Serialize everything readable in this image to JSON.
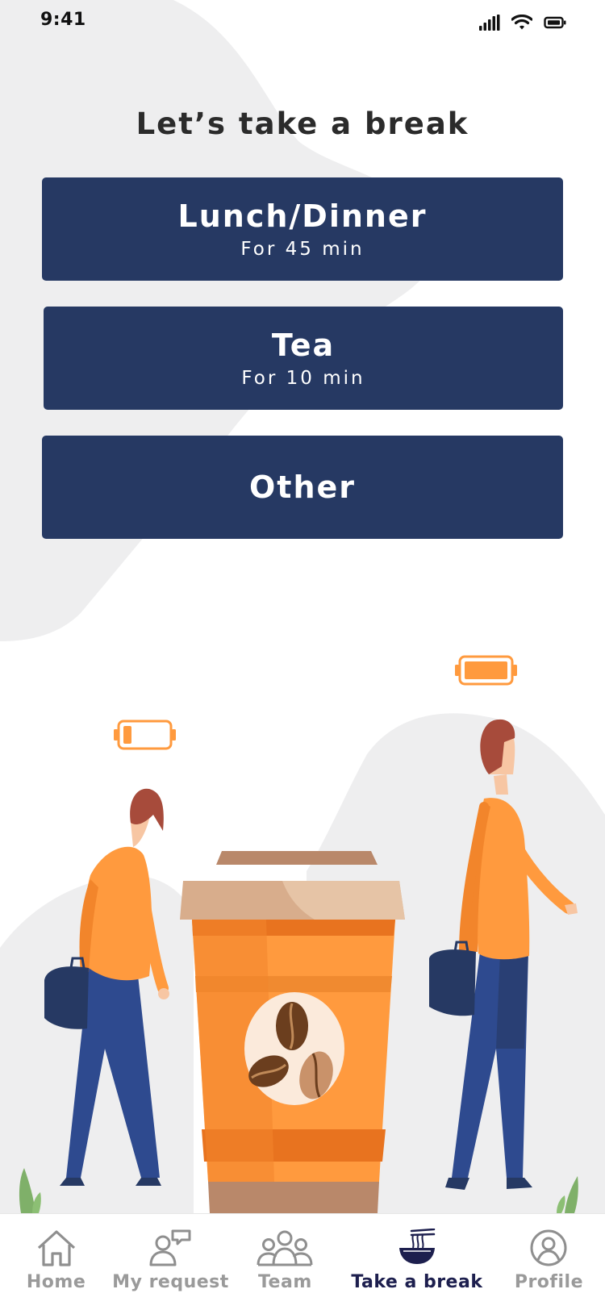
{
  "status_bar": {
    "time": "9:41"
  },
  "page": {
    "title": "Let’s take a break"
  },
  "options": [
    {
      "title": "Lunch/Dinner",
      "subtitle": "For 45 min"
    },
    {
      "title": "Tea",
      "subtitle": "For 10 min"
    },
    {
      "title": "Other"
    }
  ],
  "tabs": [
    {
      "label": "Home",
      "icon": "home-icon"
    },
    {
      "label": "My request",
      "icon": "request-icon"
    },
    {
      "label": "Team",
      "icon": "team-icon"
    },
    {
      "label": "Take a break",
      "icon": "noodle-bowl-icon",
      "active": true
    },
    {
      "label": "Profile",
      "icon": "profile-icon"
    }
  ],
  "colors": {
    "button_bg": "#263963",
    "accent_orange": "#ff9a3e",
    "active_tab": "#1d1f4e",
    "inactive_tab": "#9a9a9a",
    "blob": "#eeeeef"
  }
}
